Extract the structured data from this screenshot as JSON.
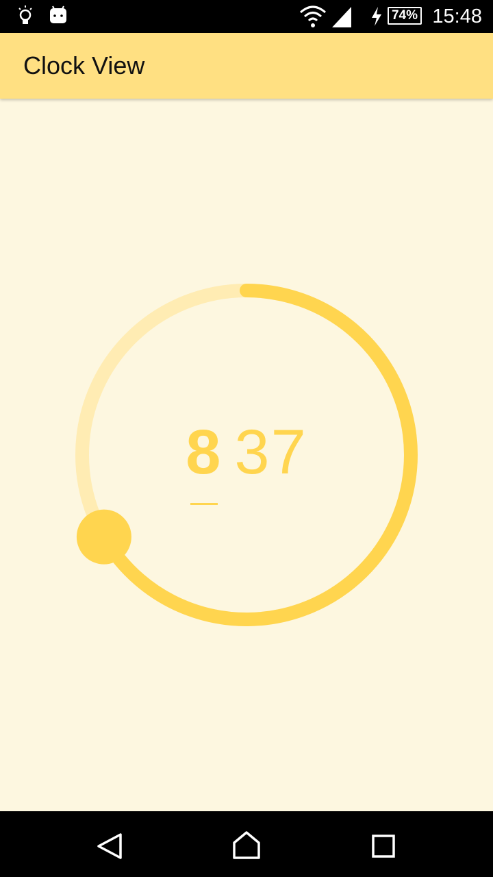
{
  "status_bar": {
    "time": "15:48",
    "battery_percent": "74%",
    "icons": [
      "lightbulb-icon",
      "android-icon",
      "wifi-icon",
      "cell-signal-icon",
      "charging-bolt-icon",
      "battery-icon"
    ]
  },
  "app_bar": {
    "title": "Clock View"
  },
  "clock": {
    "hour": "8",
    "minute": "37",
    "selected_unit": "hour",
    "dial_progress": 0.667,
    "colors": {
      "background": "#FDF7E0",
      "app_bar": "#FFE082",
      "accent": "#FFD54F",
      "track": "#FFECB3"
    }
  },
  "nav_bar": {
    "icons": [
      "back-icon",
      "home-icon",
      "recents-icon"
    ]
  }
}
